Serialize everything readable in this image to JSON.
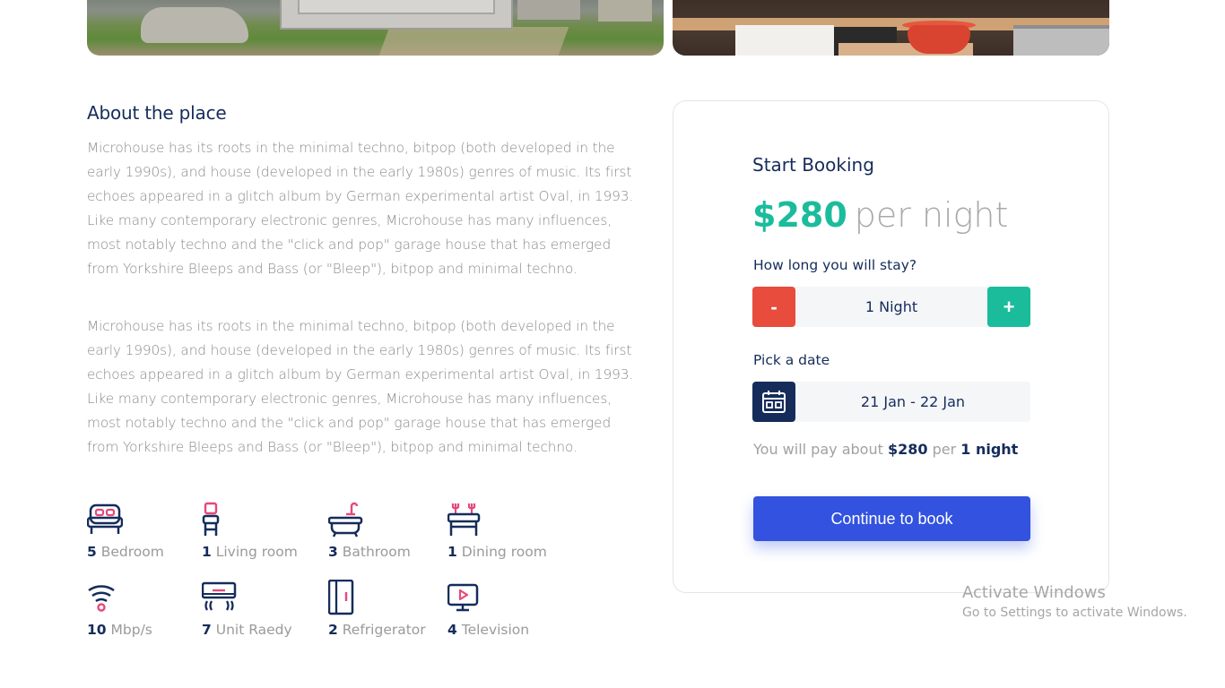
{
  "about": {
    "title": "About the place",
    "paragraphs": [
      "Microhouse has its roots in the minimal techno, bitpop (both developed in the early 1990s), and house (developed in the early 1980s) genres of music. Its first echoes appeared in a glitch album by German experimental artist Oval, in 1993. Like many contemporary electronic genres, Microhouse has many influences, most notably techno and the \"click and pop\" garage house that has emerged from Yorkshire Bleeps and Bass (or \"Bleep\"), bitpop and minimal techno.",
      "Microhouse has its roots in the minimal techno, bitpop (both developed in the early 1990s), and house (developed in the early 1980s) genres of music. Its first echoes appeared in a glitch album by German experimental artist Oval, in 1993. Like many contemporary electronic genres, Microhouse has many influences, most notably techno and the \"click and pop\" garage house that has emerged from Yorkshire Bleeps and Bass (or \"Bleep\"), bitpop and minimal techno."
    ]
  },
  "features": [
    {
      "icon": "bed-icon",
      "count": "5",
      "label": "Bedroom"
    },
    {
      "icon": "chair-icon",
      "count": "1",
      "label": "Living room"
    },
    {
      "icon": "bathtub-icon",
      "count": "3",
      "label": "Bathroom"
    },
    {
      "icon": "dining-table-icon",
      "count": "1",
      "label": "Dining room"
    },
    {
      "icon": "wifi-icon",
      "count": "10",
      "label": "Mbp/s"
    },
    {
      "icon": "air-conditioner-icon",
      "count": "7",
      "label": "Unit Raedy"
    },
    {
      "icon": "refrigerator-icon",
      "count": "2",
      "label": "Refrigerator"
    },
    {
      "icon": "television-icon",
      "count": "4",
      "label": "Television"
    }
  ],
  "booking": {
    "title": "Start Booking",
    "price": "$280",
    "per": "per night",
    "stay_label": "How long you will stay?",
    "minus_label": "-",
    "plus_label": "+",
    "nights_value": "1 Night",
    "date_label": "Pick a date",
    "date_value": "21 Jan - 22 Jan",
    "pay_prefix": "You will pay about",
    "pay_amount": "$280",
    "pay_per": "per",
    "pay_nights": "1 night",
    "cta_label": "Continue to book"
  },
  "colors": {
    "primary": "#152c5b",
    "accent_green": "#1abc9c",
    "accent_red": "#e74c3c",
    "cta_blue": "#3252df",
    "icon_pink": "#e5497b"
  },
  "watermark": {
    "title": "Activate Windows",
    "subtitle": "Go to Settings to activate Windows."
  }
}
